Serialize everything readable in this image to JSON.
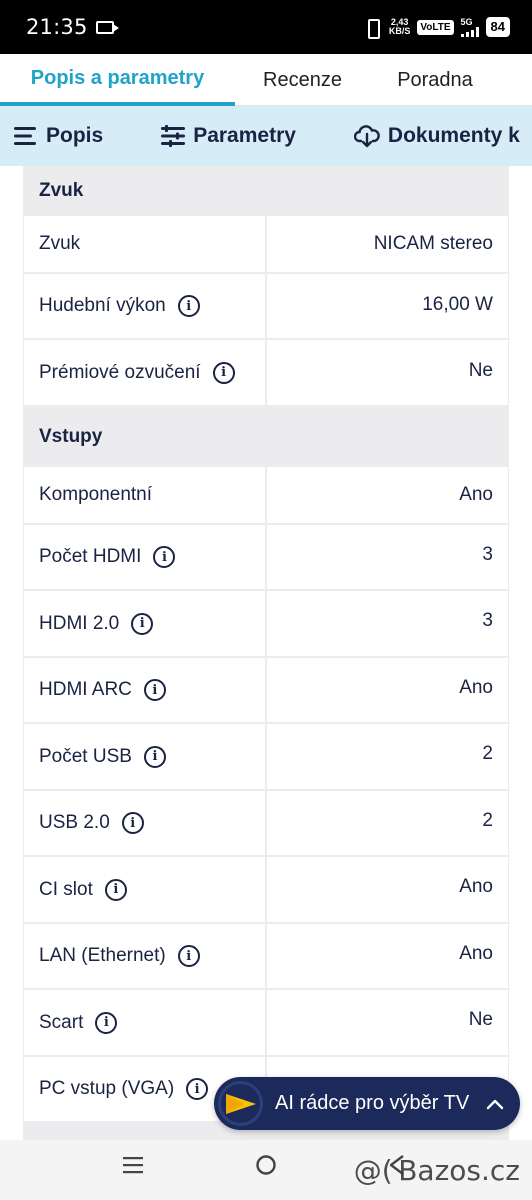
{
  "status": {
    "time": "21:35",
    "speed_value": "2,43",
    "speed_unit": "KB/S",
    "volte": "VoLTE",
    "network": "5G",
    "battery": "84"
  },
  "tabs": [
    {
      "label": "Popis a parametry",
      "active": true
    },
    {
      "label": "Recenze",
      "active": false
    },
    {
      "label": "Poradna",
      "active": false
    }
  ],
  "subnav": [
    {
      "label": "Popis",
      "icon": "menu-lines-icon"
    },
    {
      "label": "Parametry",
      "icon": "sliders-icon"
    },
    {
      "label": "Dokumenty k",
      "icon": "cloud-download-icon"
    }
  ],
  "sections": [
    {
      "title": "Zvuk",
      "rows": [
        {
          "label": "Zvuk",
          "value": "NICAM stereo",
          "info": false
        },
        {
          "label": "Hudební výkon",
          "value": "16,00 W",
          "info": true
        },
        {
          "label": "Prémiové ozvučení",
          "value": "Ne",
          "info": true
        }
      ]
    },
    {
      "title": "Vstupy",
      "rows": [
        {
          "label": "Komponentní",
          "value": "Ano",
          "info": false
        },
        {
          "label": "Počet HDMI",
          "value": "3",
          "info": true
        },
        {
          "label": "HDMI 2.0",
          "value": "3",
          "info": true
        },
        {
          "label": "HDMI ARC",
          "value": "Ano",
          "info": true
        },
        {
          "label": "Počet USB",
          "value": "2",
          "info": true
        },
        {
          "label": "USB 2.0",
          "value": "2",
          "info": true
        },
        {
          "label": "CI slot",
          "value": "Ano",
          "info": true
        },
        {
          "label": "LAN (Ethernet)",
          "value": "Ano",
          "info": true
        },
        {
          "label": "Scart",
          "value": "Ne",
          "info": true
        },
        {
          "label": "PC vstup (VGA)",
          "value": "",
          "info": true
        }
      ]
    }
  ],
  "info_glyph": "i",
  "ai_button": {
    "label": "AI rádce pro výběr TV"
  },
  "watermark": "@( Bazos.cz",
  "colors": {
    "accent": "#1fa3c9",
    "navy": "#1b2344",
    "subnav_bg": "#d6ecf6",
    "ai_bg": "#1b2a5a"
  }
}
